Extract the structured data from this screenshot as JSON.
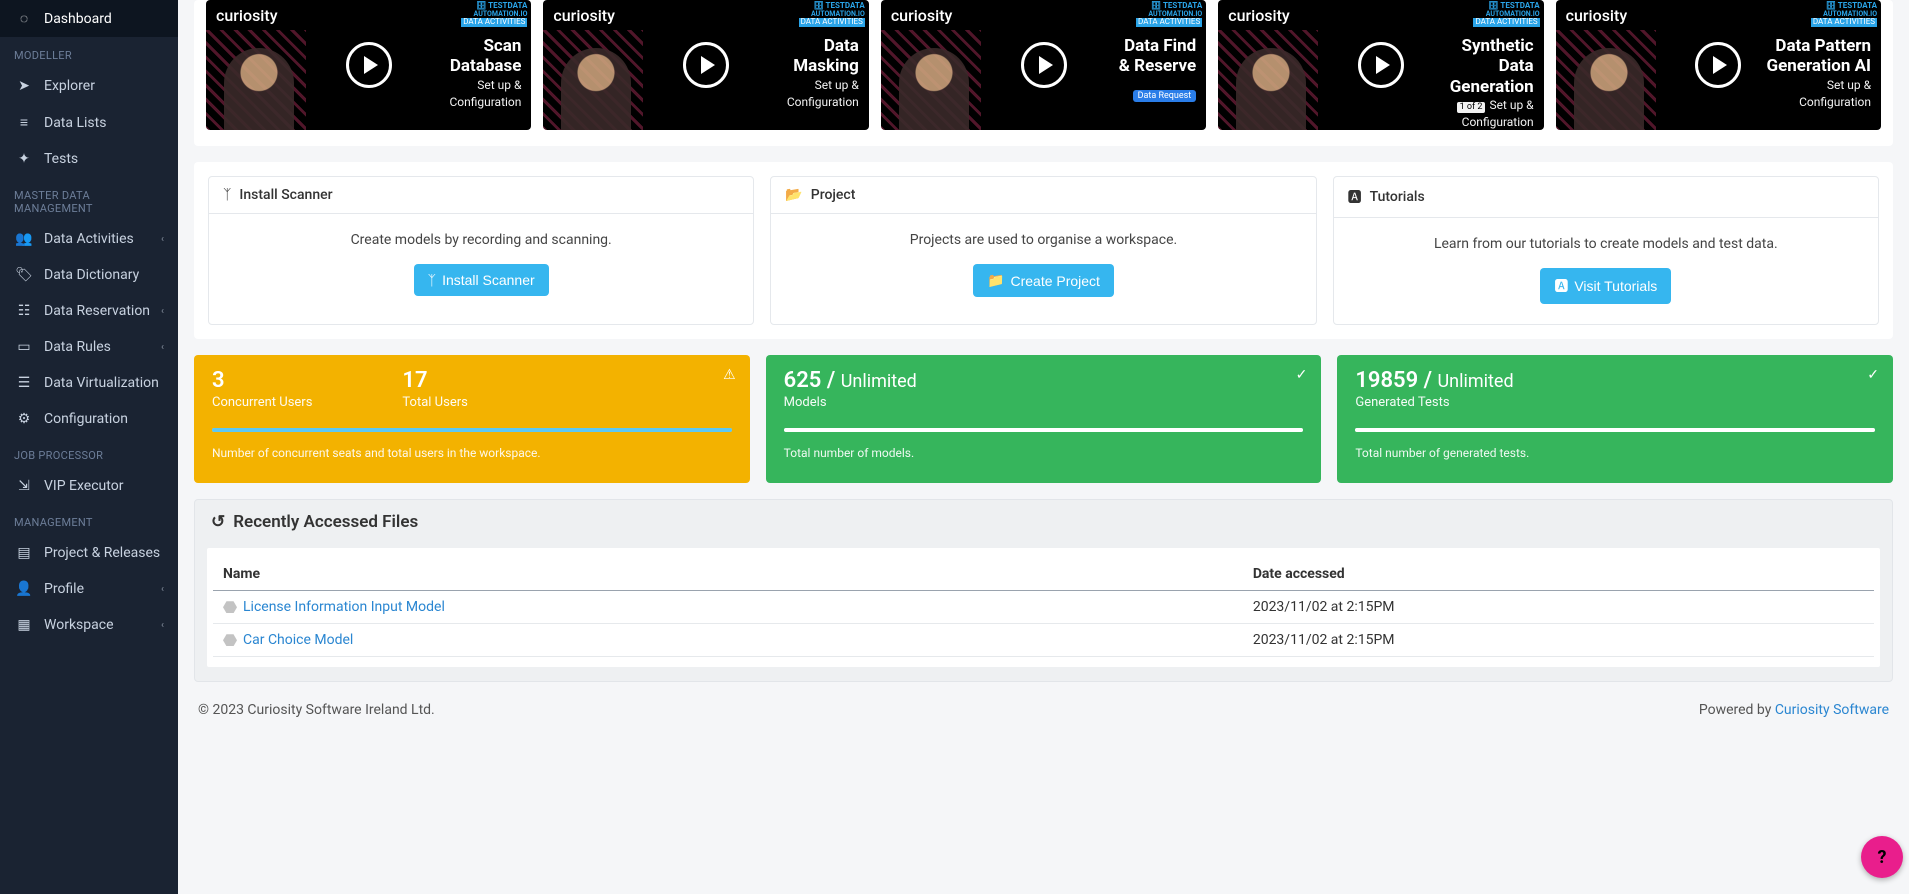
{
  "sidebar": {
    "dashboard": "Dashboard",
    "sections": {
      "modeller": "MODELLER",
      "mdm": "MASTER DATA MANAGEMENT",
      "jobproc": "JOB PROCESSOR",
      "management": "MANAGEMENT"
    },
    "items": {
      "explorer": "Explorer",
      "datalists": "Data Lists",
      "tests": "Tests",
      "dataactivities": "Data Activities",
      "datadictionary": "Data Dictionary",
      "datareservation": "Data Reservation",
      "datarules": "Data Rules",
      "datavirtualization": "Data Virtualization",
      "configuration": "Configuration",
      "vipexecutor": "VIP Executor",
      "projectreleases": "Project & Releases",
      "profile": "Profile",
      "workspace": "Workspace"
    }
  },
  "videos": [
    {
      "brand": "curiosity",
      "title1": "Scan",
      "title2": "Database",
      "sub1": "Set up &",
      "sub2": "Configuration",
      "badge1": "TESTDATA",
      "badge2": "AUTOMATION.IO",
      "badge3": "DATA ACTIVITIES"
    },
    {
      "brand": "curiosity",
      "title1": "Data",
      "title2": "Masking",
      "sub1": "Set up &",
      "sub2": "Configuration",
      "badge1": "TESTDATA",
      "badge2": "AUTOMATION.IO",
      "badge3": "DATA ACTIVITIES"
    },
    {
      "brand": "curiosity",
      "title1": "Data Find",
      "title2": "& Reserve",
      "sub1": "",
      "sub2": "",
      "extra": "Data Request",
      "badge1": "TESTDATA",
      "badge2": "AUTOMATION.IO",
      "badge3": "DATA ACTIVITIES"
    },
    {
      "brand": "curiosity",
      "title1": "Synthetic",
      "title2": "Data",
      "title3": "Generation",
      "sub1": "Set up &",
      "sub2": "Configuration",
      "part": "1 of 2",
      "badge1": "TESTDATA",
      "badge2": "AUTOMATION.IO",
      "badge3": "DATA ACTIVITIES"
    },
    {
      "brand": "curiosity",
      "title1": "Data Pattern",
      "title2": "Generation AI",
      "sub1": "Set up &",
      "sub2": "Configuration",
      "badge1": "TESTDATA",
      "badge2": "AUTOMATION.IO",
      "badge3": "DATA ACTIVITIES"
    }
  ],
  "cards": {
    "scanner": {
      "title": "Install Scanner",
      "desc": "Create models by recording and scanning.",
      "btn": "Install Scanner"
    },
    "project": {
      "title": "Project",
      "desc": "Projects are used to organise a workspace.",
      "btn": "Create Project"
    },
    "tutorials": {
      "title": "Tutorials",
      "desc": "Learn from our tutorials to create models and test data.",
      "btn": "Visit Tutorials"
    }
  },
  "stats": {
    "users": {
      "concurrent": "3",
      "concurrent_label": "Concurrent Users",
      "total": "17",
      "total_label": "Total Users",
      "foot": "Number of concurrent seats and total users in the workspace."
    },
    "models": {
      "val": "625",
      "sep": " / ",
      "limit": "Unlimited",
      "label": "Models",
      "foot": "Total number of models."
    },
    "tests": {
      "val": "19859",
      "sep": " / ",
      "limit": "Unlimited",
      "label": "Generated Tests",
      "foot": "Total number of generated tests."
    }
  },
  "recent": {
    "title": "Recently Accessed Files",
    "cols": {
      "name": "Name",
      "date": "Date accessed"
    },
    "rows": [
      {
        "name": "License Information Input Model",
        "date": "2023/11/02 at 2:15PM"
      },
      {
        "name": "Car Choice Model",
        "date": "2023/11/02 at 2:15PM"
      }
    ]
  },
  "footer": {
    "copyright": "© 2023 Curiosity Software Ireland Ltd.",
    "powered_pre": "Powered by ",
    "powered_link": "Curiosity Software"
  },
  "help": "?"
}
